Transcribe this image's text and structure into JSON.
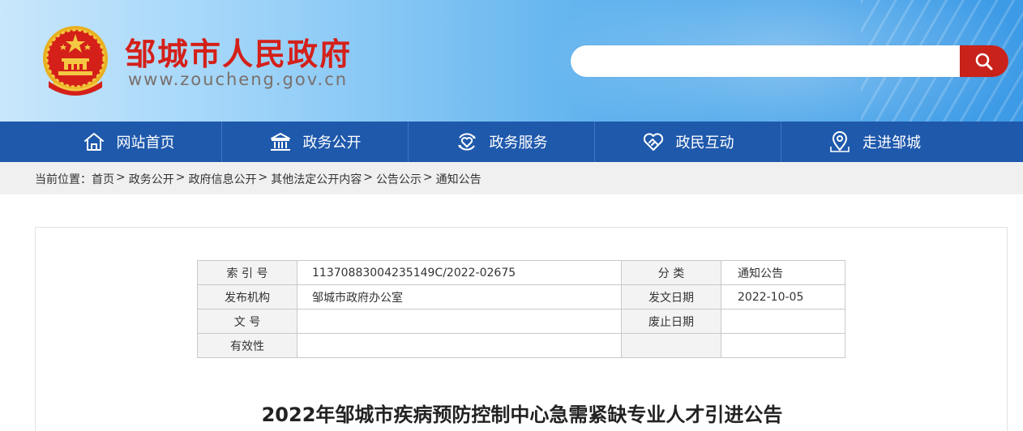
{
  "header": {
    "site_title": "邹城市人民政府",
    "site_url": "www.zoucheng.gov.cn",
    "search_placeholder": "",
    "accent_color": "#c8221a"
  },
  "nav": {
    "items": [
      {
        "label": "网站首页",
        "icon": "home-icon"
      },
      {
        "label": "政务公开",
        "icon": "government-building-icon"
      },
      {
        "label": "政务服务",
        "icon": "heart-service-icon"
      },
      {
        "label": "政民互动",
        "icon": "handshake-icon"
      },
      {
        "label": "走进邹城",
        "icon": "location-pin-icon"
      }
    ],
    "background": "#1f59ac"
  },
  "breadcrumb": {
    "prefix": "当前位置：",
    "items": [
      "首页",
      "政务公开",
      "政府信息公开",
      "其他法定公开内容",
      "公告公示",
      "通知公告"
    ],
    "separator": ">"
  },
  "meta": {
    "rows": [
      {
        "k1": "索  引  号",
        "v1": "11370883004235149C/2022-02675",
        "k2": "分      类",
        "v2": "通知公告"
      },
      {
        "k1": "发布机构",
        "v1": "邹城市政府办公室",
        "k2": "发文日期",
        "v2": "2022-10-05"
      },
      {
        "k1": "文      号",
        "v1": "",
        "k2": "废止日期",
        "v2": ""
      },
      {
        "k1": "有效性",
        "v1": "",
        "k2": "",
        "v2": ""
      }
    ]
  },
  "article": {
    "title": "2022年邹城市疾病预防控制中心急需紧缺专业人才引进公告"
  }
}
